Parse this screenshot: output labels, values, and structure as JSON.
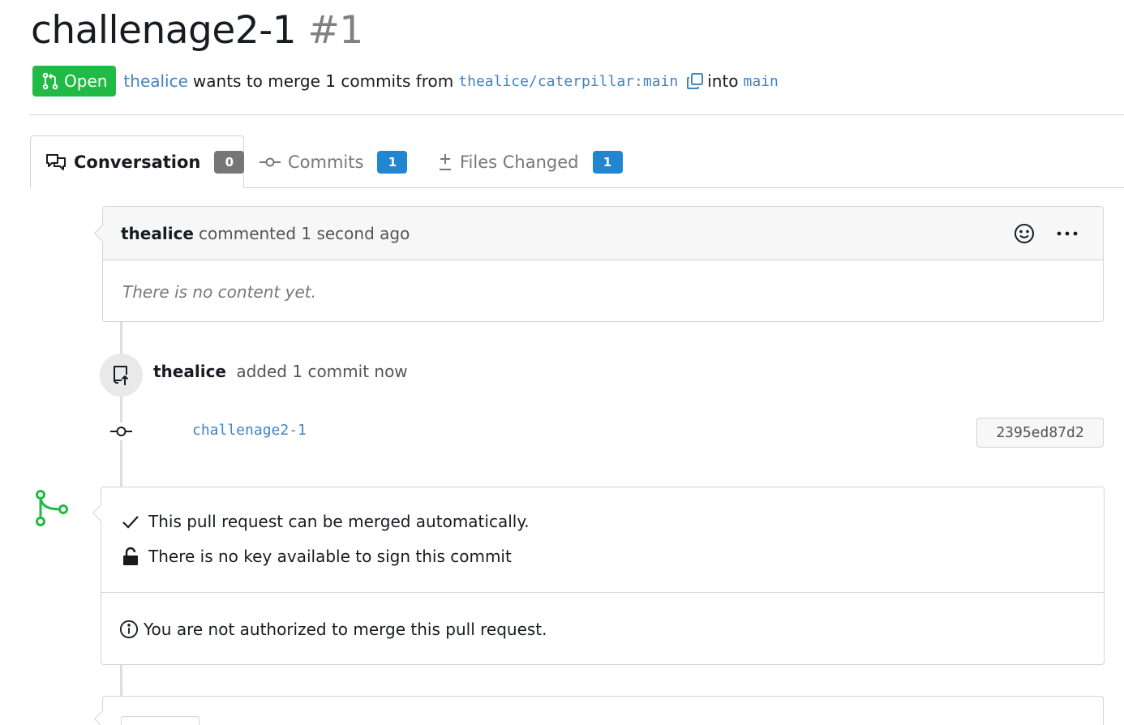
{
  "pr": {
    "title": "challenage2-1",
    "number": "#1",
    "status": "Open",
    "author": "thealice",
    "merge_text": "wants to merge 1 commits from",
    "source_branch": "thealice/caterpillar:main",
    "into_text": "into",
    "target_branch": "main"
  },
  "tabs": [
    {
      "label": "Conversation",
      "count": "0",
      "icon": "comments-icon"
    },
    {
      "label": "Commits",
      "count": "1",
      "icon": "commit-icon"
    },
    {
      "label": "Files Changed",
      "count": "1",
      "icon": "diff-icon"
    }
  ],
  "comment": {
    "author": "thealice",
    "action": "commented 1 second ago",
    "body": "There is no content yet."
  },
  "commit_event": {
    "author": "thealice",
    "action": "added 1 commit now",
    "commit_message": "challenage2-1",
    "commit_sha": "2395ed87d2"
  },
  "merge_box": {
    "can_merge": "This pull request can be merged automatically.",
    "sign_status": "There is no key available to sign this commit",
    "auth_message": "You are not authorized to merge this pull request."
  },
  "colors": {
    "open_green": "#21ba45",
    "link_blue": "#4183c4",
    "count_blue": "#2185d0",
    "count_grey": "#767676"
  }
}
